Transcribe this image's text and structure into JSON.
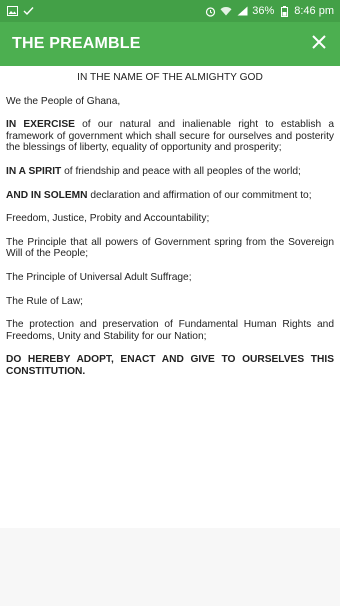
{
  "status_bar": {
    "battery": "36%",
    "time": "8:46 pm"
  },
  "app_bar": {
    "title": "THE PREAMBLE"
  },
  "document": {
    "heading": "IN THE NAME OF THE ALMIGHTY GOD",
    "paragraphs": [
      {
        "bold": "",
        "text": "We the People of Ghana,"
      },
      {
        "bold": "IN EXERCISE",
        "text": " of our natural and inalienable right to establish a framework of government which shall secure for ourselves and posterity the blessings of liberty, equality of opportunity and prosperity;"
      },
      {
        "bold": "IN A SPIRIT",
        "text": " of friendship and peace with all peoples of the world;"
      },
      {
        "bold": "AND IN SOLEMN",
        "text": " declaration and affirmation of our commitment to;"
      },
      {
        "bold": "",
        "text": "Freedom, Justice, Probity and Accountability;"
      },
      {
        "bold": "",
        "text": "The Principle that all powers of Government spring from the Sovereign Will of the People;"
      },
      {
        "bold": "",
        "text": "The Principle of Universal Adult Suffrage;"
      },
      {
        "bold": "",
        "text": "The Rule of Law;"
      },
      {
        "bold": "",
        "text": "The protection and preservation of Fundamental Human Rights and Freedoms, Unity and Stability for our Nation;"
      },
      {
        "bold": "DO HEREBY ADOPT, ENACT AND GIVE TO OURSELVES THIS CONSTITUTION.",
        "text": ""
      }
    ]
  },
  "icons": {
    "image": "image-icon",
    "check": "check-icon",
    "alarm": "alarm-icon",
    "wifi": "wifi-icon",
    "signal": "signal-icon",
    "battery": "battery-icon",
    "close": "close-icon"
  },
  "colors": {
    "status_bar": "#43a047",
    "app_bar": "#4caf50",
    "text": "#222222"
  }
}
